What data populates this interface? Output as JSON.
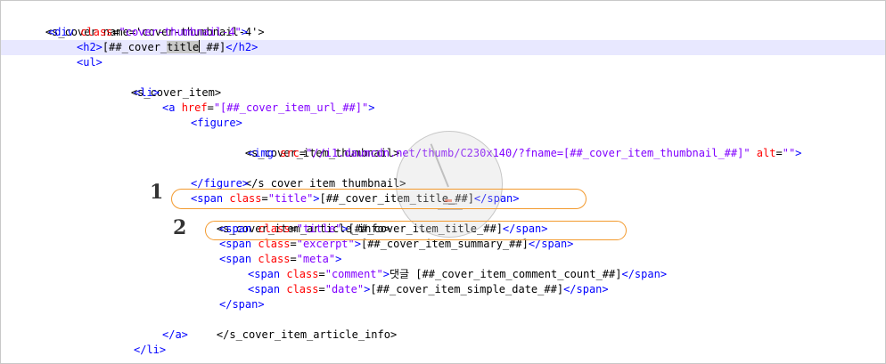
{
  "code_lines": [
    "<s_cover name='cover-thumbnail-4'>",
    "<div class=\"cover-thumbnail-4\">",
    "<h2>[##_cover_title_##]</h2>",
    "<ul>",
    "<s_cover_item>",
    "<li>",
    "<a href=\"[##_cover_item_url_##]\">",
    "<figure>",
    "<s_cover_item_thumbnail>",
    "<img src=\"//i1.daumcdn.net/thumb/C230x140/?fname=[##_cover_item_thumbnail_##]\" alt=\"\">",
    "</s_cover_item_thumbnail>",
    "</figure>",
    "<span class=\"title\">[##_cover_item_title_##]</span>",
    "<s_cover_item_article_info>",
    "<span class=\"title\">[##_cover_item_title_##]</span>",
    "<span class=\"excerpt\">[##_cover_item_summary_##]</span>",
    "<span class=\"meta\">",
    "<span class=\"comment\">댓글 [##_cover_item_comment_count_##]</span>",
    "<span class=\"date\">[##_cover_item_simple_date_##]</span>",
    "</span>",
    "</s_cover_item_article_info>",
    "</a>",
    "</li>"
  ],
  "annotations": [
    "1",
    "2"
  ],
  "colors": {
    "tag": "#0000ff",
    "attribute": "#ff0000",
    "value": "#8000ff",
    "highlight_line": "#e8e8ff",
    "annotation_outline": "#f39a2e"
  },
  "watermark_icon": "clock-watermark-icon"
}
